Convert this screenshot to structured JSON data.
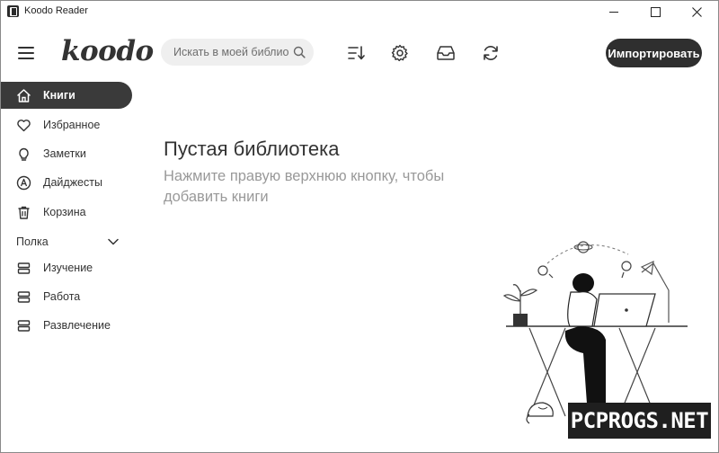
{
  "window": {
    "title": "Koodo Reader"
  },
  "header": {
    "logo": "koodo",
    "search_placeholder": "Искать в моей библиотеке",
    "import_label": "Импортировать",
    "tools": [
      "sort-icon",
      "gear-icon",
      "inbox-icon",
      "sync-icon"
    ]
  },
  "sidebar": {
    "items": [
      {
        "label": "Книги",
        "icon": "home-icon",
        "active": true
      },
      {
        "label": "Избранное",
        "icon": "heart-icon"
      },
      {
        "label": "Заметки",
        "icon": "lightbulb-icon"
      },
      {
        "label": "Дайджесты",
        "icon": "highlight-icon"
      },
      {
        "label": "Корзина",
        "icon": "trash-icon"
      }
    ],
    "shelf_title": "Полка",
    "shelves": [
      {
        "label": "Изучение",
        "icon": "shelf-icon"
      },
      {
        "label": "Работа",
        "icon": "shelf-icon"
      },
      {
        "label": "Развлечение",
        "icon": "shelf-icon"
      }
    ]
  },
  "empty_state": {
    "title": "Пустая библиотека",
    "hint": "Нажмите правую верхнюю кнопку, чтобы добавить книги"
  },
  "watermark": "PCPROGS.NET",
  "colors": {
    "accent": "#3a3a3a",
    "button": "#2f2f2f",
    "search_bg": "#efefef",
    "hint": "#999999"
  }
}
